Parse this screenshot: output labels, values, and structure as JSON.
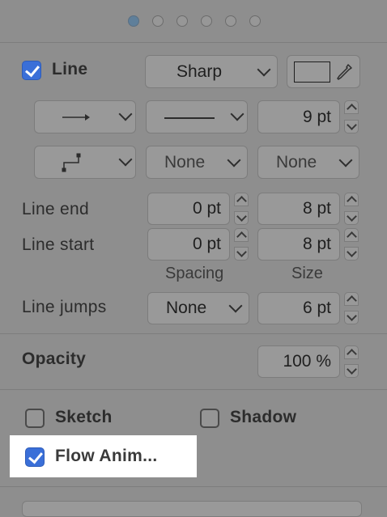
{
  "pager": {
    "dots": [
      true,
      false,
      false,
      false,
      false,
      false
    ]
  },
  "line": {
    "checked": true,
    "label": "Line",
    "style_select": "Sharp",
    "color_swatch": "#9a9a9a",
    "width": "9 pt",
    "row3": {
      "start_select": "None",
      "end_select": "None"
    }
  },
  "line_end": {
    "label": "Line end",
    "spacing": "0 pt",
    "size": "8 pt"
  },
  "line_start": {
    "label": "Line start",
    "spacing": "0 pt",
    "size": "8 pt"
  },
  "captions": {
    "spacing": "Spacing",
    "size": "Size"
  },
  "line_jumps": {
    "label": "Line jumps",
    "select": "None",
    "size": "6 pt"
  },
  "opacity": {
    "label": "Opacity",
    "value": "100 %"
  },
  "options": {
    "sketch": {
      "label": "Sketch",
      "checked": false
    },
    "shadow": {
      "label": "Shadow",
      "checked": false
    },
    "flow": {
      "label": "Flow Anim...",
      "checked": true
    }
  },
  "colors": {
    "accent": "#3a6fd8",
    "panel": "#8e8e8e",
    "highlight": "#ffffff"
  }
}
